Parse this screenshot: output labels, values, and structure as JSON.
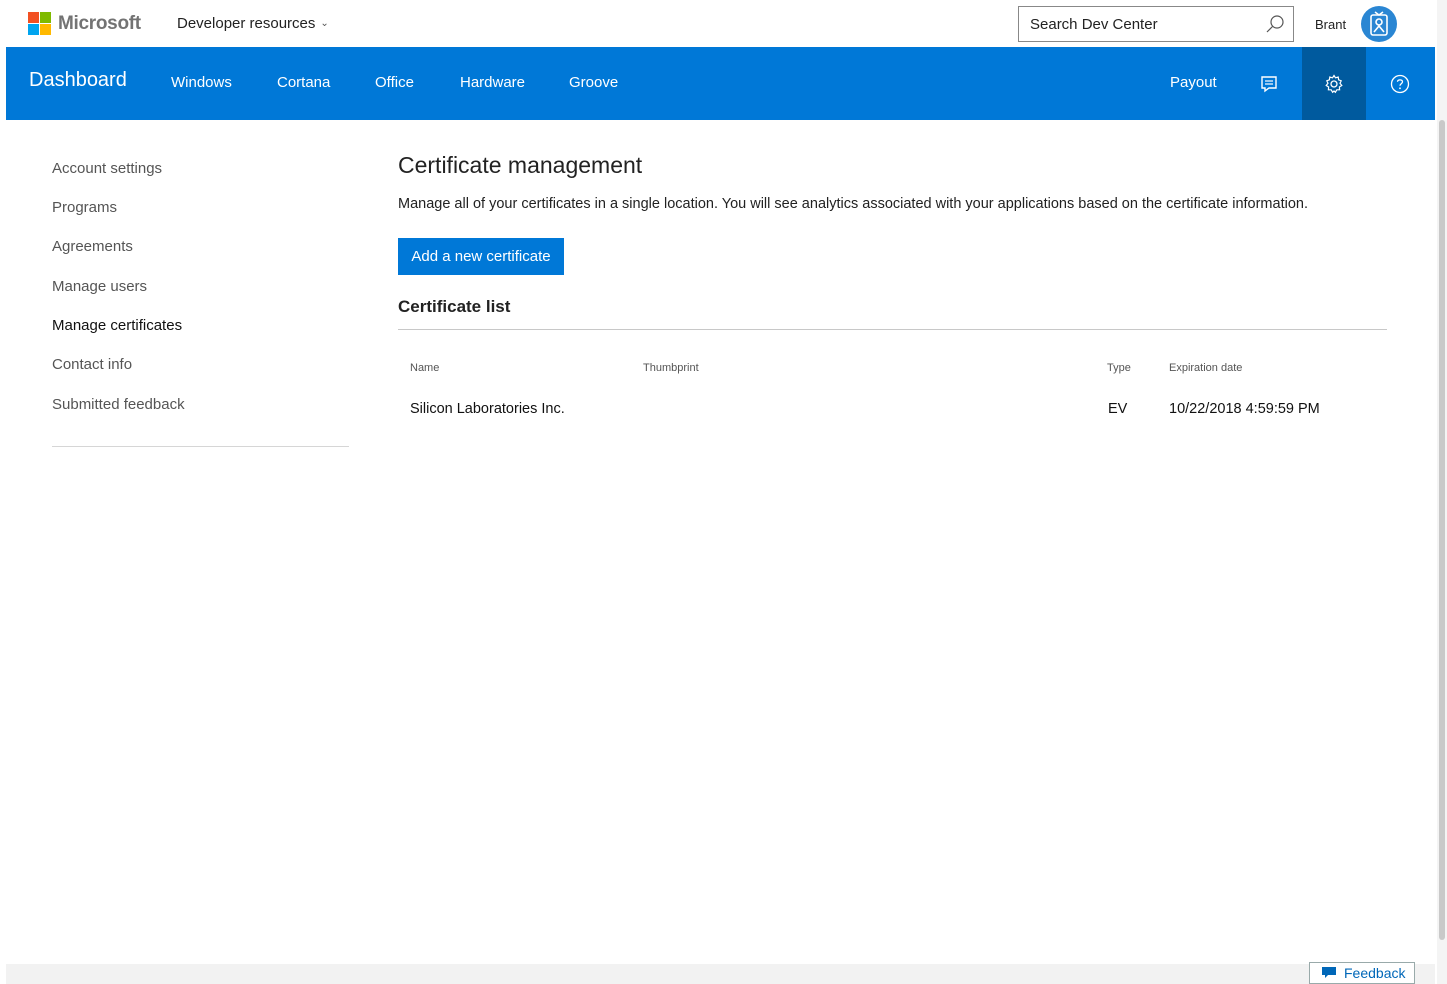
{
  "header": {
    "brand": "Microsoft",
    "brand_colors": [
      "#f25022",
      "#7fba00",
      "#00a4ef",
      "#ffb900"
    ],
    "dev_resources": "Developer resources",
    "search_placeholder": "Search Dev Center",
    "user_name": "Brant"
  },
  "nav": {
    "dashboard": "Dashboard",
    "items": [
      "Windows",
      "Cortana",
      "Office",
      "Hardware",
      "Groove"
    ],
    "payout": "Payout",
    "icons": [
      "feedback-message-icon",
      "gear-icon",
      "help-icon"
    ],
    "accent": "#0078d7"
  },
  "sidebar": {
    "items": [
      {
        "label": "Account settings",
        "selected": false
      },
      {
        "label": "Programs",
        "selected": false
      },
      {
        "label": "Agreements",
        "selected": false
      },
      {
        "label": "Manage users",
        "selected": false
      },
      {
        "label": "Manage certificates",
        "selected": true
      },
      {
        "label": "Contact info",
        "selected": false
      },
      {
        "label": "Submitted feedback",
        "selected": false
      }
    ]
  },
  "main": {
    "title": "Certificate management",
    "description": "Manage all of your certificates in a single location. You will see analytics associated with your applications based on the certificate information.",
    "add_button": "Add a new certificate",
    "list_title": "Certificate list",
    "columns": [
      "Name",
      "Thumbprint",
      "Type",
      "Expiration date"
    ],
    "rows": [
      {
        "name": "Silicon Laboratories Inc.",
        "thumbprint": "",
        "type": "EV",
        "expiration": "10/22/2018 4:59:59 PM"
      }
    ]
  },
  "footer": {
    "feedback": "Feedback"
  }
}
